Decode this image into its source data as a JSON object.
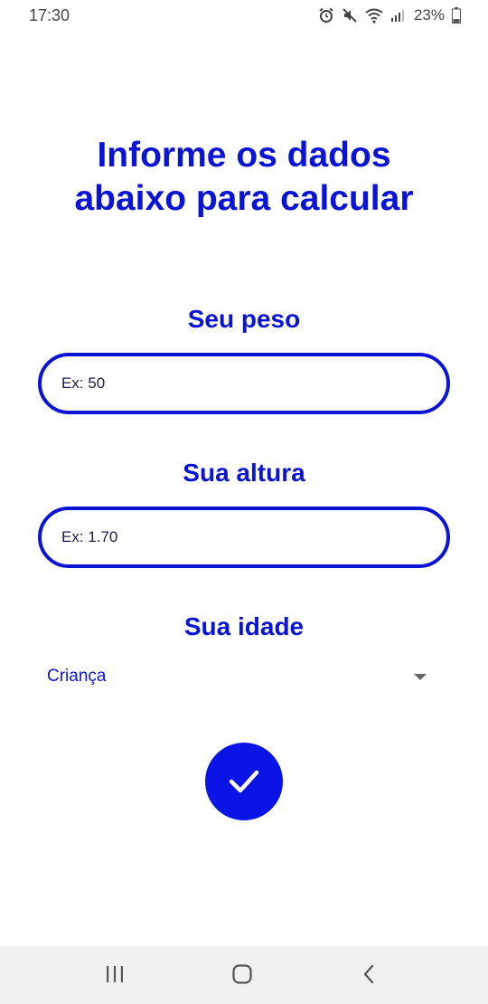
{
  "status_bar": {
    "time": "17:30",
    "battery": "23%",
    "icons": [
      "alarm-icon",
      "mute-icon",
      "wifi-icon",
      "signal-icon",
      "battery-icon"
    ]
  },
  "form": {
    "title_line1": "Informe os dados",
    "title_line2": "abaixo para calcular",
    "weight_label": "Seu peso",
    "weight_placeholder": "Ex: 50",
    "height_label": "Sua altura",
    "height_placeholder": "Ex: 1.70",
    "age_label": "Sua idade",
    "age_selected": "Criança",
    "confirm_icon": "check-icon"
  },
  "nav_bar": {
    "buttons": [
      "recents-icon",
      "home-icon",
      "back-icon"
    ]
  },
  "colors": {
    "accent": "#0a14d6",
    "button": "#0a14e6",
    "nav_background": "#f0f0f0"
  }
}
